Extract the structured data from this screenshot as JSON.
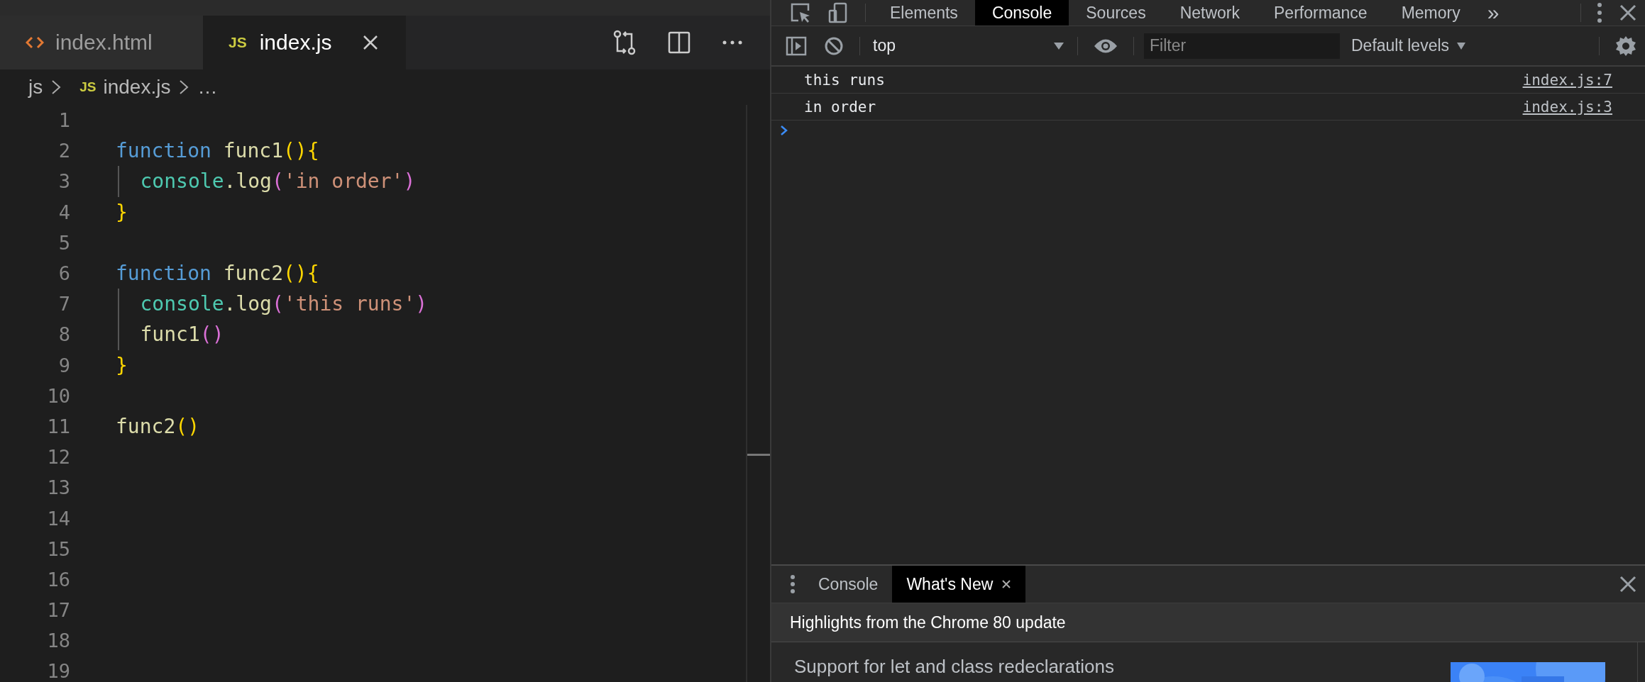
{
  "editor": {
    "tabs": [
      {
        "label": "index.html",
        "kind": "html",
        "selected": false
      },
      {
        "label": "index.js",
        "kind": "js",
        "badge": "JS",
        "selected": true
      }
    ],
    "breadcrumb": {
      "folder": "js",
      "badge": "JS",
      "file": "index.js",
      "more": "…"
    },
    "lines": [
      {
        "number": "1",
        "indented": false
      },
      {
        "number": "2",
        "indented": false,
        "tokens": [
          {
            "kind": "keyword",
            "text": "function"
          },
          {
            "kind": "name",
            "text": "func1"
          },
          {
            "kind": "brace",
            "text": "(){"
          }
        ]
      },
      {
        "number": "3",
        "indented": true,
        "tokens": [
          {
            "kind": "object",
            "text": "console"
          },
          {
            "kind": "name",
            "text": ".log"
          },
          {
            "kind": "paren",
            "text": "("
          },
          {
            "kind": "string",
            "text": "'in order'"
          },
          {
            "kind": "paren",
            "text": ")"
          }
        ]
      },
      {
        "number": "4",
        "indented": false,
        "tokens": [
          {
            "kind": "brace",
            "text": "}"
          }
        ]
      },
      {
        "number": "5",
        "indented": false
      },
      {
        "number": "6",
        "indented": false,
        "tokens": [
          {
            "kind": "keyword",
            "text": "function"
          },
          {
            "kind": "name",
            "text": "func2"
          },
          {
            "kind": "brace",
            "text": "(){"
          }
        ]
      },
      {
        "number": "7",
        "indented": true,
        "tokens": [
          {
            "kind": "object",
            "text": "console"
          },
          {
            "kind": "name",
            "text": ".log"
          },
          {
            "kind": "paren",
            "text": "("
          },
          {
            "kind": "string",
            "text": "'this runs'"
          },
          {
            "kind": "paren",
            "text": ")"
          }
        ]
      },
      {
        "number": "8",
        "indented": true,
        "tokens": [
          {
            "kind": "name",
            "text": "func1"
          },
          {
            "kind": "paren",
            "text": "()"
          }
        ]
      },
      {
        "number": "9",
        "indented": false,
        "tokens": [
          {
            "kind": "brace",
            "text": "}"
          }
        ]
      },
      {
        "number": "10",
        "indented": false
      },
      {
        "number": "11",
        "indented": false,
        "tokens": [
          {
            "kind": "name",
            "text": "func2"
          },
          {
            "kind": "brace",
            "text": "()"
          }
        ]
      },
      {
        "number": "12",
        "indented": false
      },
      {
        "number": "13",
        "indented": false
      },
      {
        "number": "14",
        "indented": false
      },
      {
        "number": "15",
        "indented": false
      },
      {
        "number": "16",
        "indented": false
      },
      {
        "number": "17",
        "indented": false
      },
      {
        "number": "18",
        "indented": false
      },
      {
        "number": "19",
        "indented": false
      }
    ]
  },
  "devtools": {
    "tabs": [
      {
        "label": "Elements",
        "selected": false
      },
      {
        "label": "Console",
        "selected": true
      },
      {
        "label": "Sources",
        "selected": false
      },
      {
        "label": "Network",
        "selected": false
      },
      {
        "label": "Performance",
        "selected": false
      },
      {
        "label": "Memory",
        "selected": false
      }
    ],
    "overflow": "»",
    "toolbar": {
      "context": "top",
      "filter_placeholder": "Filter",
      "levels": "Default levels"
    },
    "messages": [
      {
        "text": "this runs",
        "source": "index.js:7"
      },
      {
        "text": "in order",
        "source": "index.js:3"
      }
    ],
    "drawer": {
      "tabs": [
        {
          "label": "Console",
          "selected": false
        },
        {
          "label": "What's New",
          "selected": true
        }
      ],
      "header": "Highlights from the Chrome 80 update",
      "feature": "Support for let and class redeclarations"
    }
  }
}
